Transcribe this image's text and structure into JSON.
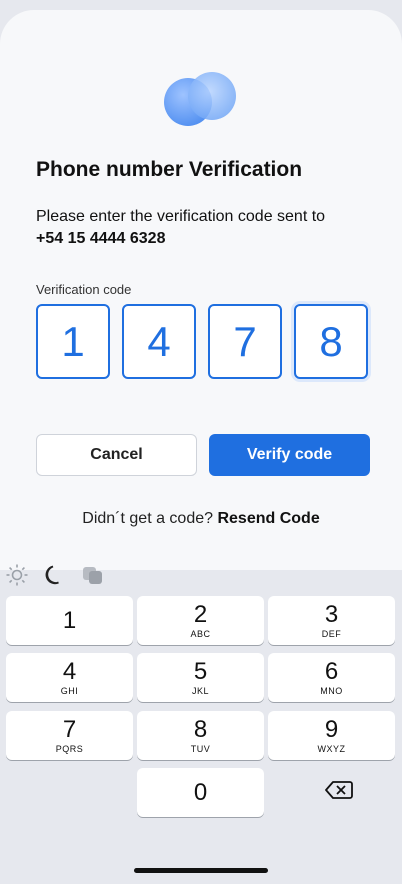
{
  "header": {
    "title": "Phone number Verification",
    "description": "Please enter the verification code sent to",
    "phone": "+54 15 4444 6328"
  },
  "code": {
    "label": "Verification code",
    "digits": [
      "1",
      "4",
      "7",
      "8"
    ]
  },
  "actions": {
    "cancel_label": "Cancel",
    "verify_label": "Verify code"
  },
  "resend": {
    "prompt": "Didn´t get a code?",
    "link": "Resend Code"
  },
  "keyboard": {
    "toolbar_icons": [
      "sun-icon",
      "moon-icon",
      "overlap-squares-icon"
    ],
    "keys": [
      {
        "num": "1",
        "letters": ""
      },
      {
        "num": "2",
        "letters": "ABC"
      },
      {
        "num": "3",
        "letters": "DEF"
      },
      {
        "num": "4",
        "letters": "GHI"
      },
      {
        "num": "5",
        "letters": "JKL"
      },
      {
        "num": "6",
        "letters": "MNO"
      },
      {
        "num": "7",
        "letters": "PQRS"
      },
      {
        "num": "8",
        "letters": "TUV"
      },
      {
        "num": "9",
        "letters": "WXYZ"
      },
      {
        "num": "0",
        "letters": ""
      }
    ]
  },
  "colors": {
    "accent": "#1f6fe0",
    "background": "#f7f8fa",
    "keyboard_bg": "#e6e8ee"
  }
}
